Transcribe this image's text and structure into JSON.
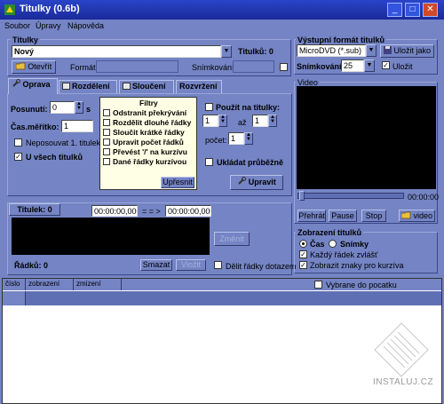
{
  "window": {
    "title": "Titulky (0.6b)"
  },
  "menu": [
    "Soubor",
    "Úpravy",
    "Nápověda"
  ],
  "titulky": {
    "group_label": "Titulky",
    "name_value": "Nový",
    "count_label": "Titulků: 0",
    "open_button": "Otevřít",
    "format_label": "Formát:",
    "frames_label": "Snímkování:"
  },
  "output": {
    "group_label": "Výstupní formát titulků",
    "format_value": "MicroDVD (*.sub)",
    "save_as_button": "Uložit jako",
    "frames_label": "Snímkování:",
    "frames_value": "25",
    "save_label": "Uložit"
  },
  "tabs": [
    "Oprava",
    "Rozdělení",
    "Sloučení",
    "Rozvržení"
  ],
  "oprava": {
    "posunuti_label": "Posunutí:",
    "posunuti_value": "0",
    "unit_s": "s",
    "meritko_label": "Čas.měřítko:",
    "meritko_value": "1",
    "neposouvat_label": "Neposouvat 1. titulek",
    "vsech_label": "U všech titulků",
    "filters_title": "Filtry",
    "filters": [
      "Odstranit překrývání",
      "Rozdělit dlouhé řádky",
      "Sloučit krátké řádky",
      "Upravit počet řádků",
      "Převést '/' na kurzívu",
      "Dané řádky kurzívou"
    ],
    "upresnit_button": "Upřesnit",
    "pouzit_label": "Použít na titulky:",
    "range_from": "1",
    "range_to_label": "až",
    "range_to": "1",
    "pocet_label": "počet:",
    "pocet_value": "1",
    "ukladat_label": "Ukládat průběžně",
    "upravit_button": "Upravit"
  },
  "editor": {
    "titulek_label": "Titulek: 0",
    "time_from": "00:00:00,000",
    "arrow": "= = >",
    "time_to": "00:00:00,000",
    "zmenit_button": "Změnit",
    "radku_label": "Řádků: 0",
    "smazat_button": "Smazat",
    "vlozit_button": "Vložit",
    "delit_label": "Dělit řádky dotazem"
  },
  "video": {
    "group_label": "Video",
    "time": "00:00:00",
    "prehrat_button": "Přehrát",
    "pause_button": "Pause",
    "stop_button": "Stop",
    "video_button": "video"
  },
  "display": {
    "group_label": "Zobrazení titulků",
    "cas_label": "Čas",
    "snimky_label": "Snímky",
    "kazdy_label": "Každý řádek zvlášť",
    "zobrazit_label": "Zobrazit znaky pro kurzíva"
  },
  "list": {
    "columns": [
      "číslo",
      "zobrazení",
      "zmizení"
    ],
    "vybrane_label": "Vybrane do pocatku"
  },
  "watermark": "INSTALUJ.CZ"
}
